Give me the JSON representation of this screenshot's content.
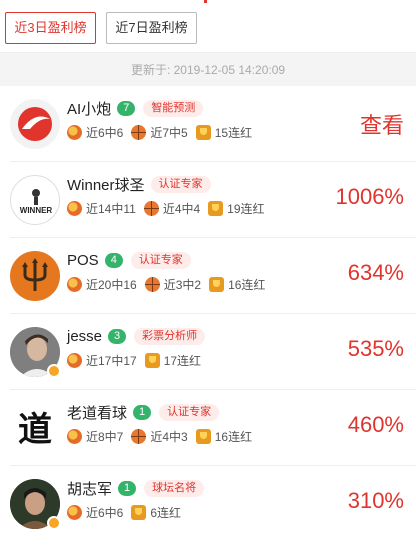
{
  "tabs": [
    {
      "label": "近3日盈利榜",
      "active": true
    },
    {
      "label": "近7日盈利榜",
      "active": false
    }
  ],
  "updated": {
    "label": "更新于:",
    "time": "2019-12-05 14:20:09"
  },
  "rows": [
    {
      "name": "AI小炮",
      "level": "7",
      "tag": "智能预测",
      "stats": [
        {
          "icon": "football-icon",
          "text": "近6中6"
        },
        {
          "icon": "basketball-icon",
          "text": "近7中5"
        },
        {
          "icon": "trophy-icon",
          "text": "15连红"
        }
      ],
      "value": "查看"
    },
    {
      "name": "Winner球圣",
      "level": "",
      "tag": "认证专家",
      "stats": [
        {
          "icon": "football-icon",
          "text": "近14中11"
        },
        {
          "icon": "basketball-icon",
          "text": "近4中4"
        },
        {
          "icon": "trophy-icon",
          "text": "19连红"
        }
      ],
      "value": "1006%"
    },
    {
      "name": "POS",
      "level": "4",
      "tag": "认证专家",
      "stats": [
        {
          "icon": "football-icon",
          "text": "近20中16"
        },
        {
          "icon": "basketball-icon",
          "text": "近3中2"
        },
        {
          "icon": "trophy-icon",
          "text": "16连红"
        }
      ],
      "value": "634%"
    },
    {
      "name": "jesse",
      "level": "3",
      "tag": "彩票分析师",
      "stats": [
        {
          "icon": "football-icon",
          "text": "近17中17"
        },
        {
          "icon": "trophy-icon",
          "text": "17连红"
        }
      ],
      "value": "535%"
    },
    {
      "name": "老道看球",
      "level": "1",
      "tag": "认证专家",
      "stats": [
        {
          "icon": "football-icon",
          "text": "近8中7"
        },
        {
          "icon": "basketball-icon",
          "text": "近4中3"
        },
        {
          "icon": "trophy-icon",
          "text": "16连红"
        }
      ],
      "value": "460%"
    },
    {
      "name": "胡志军",
      "level": "1",
      "tag": "球坛名将",
      "stats": [
        {
          "icon": "football-icon",
          "text": "近6中6"
        },
        {
          "icon": "trophy-icon",
          "text": "6连红"
        }
      ],
      "value": "310%"
    }
  ],
  "avatar_texts": {
    "winner": "WINNER",
    "dao": "道"
  },
  "colors": {
    "accent": "#e0342d",
    "level": "#34b46b",
    "tag_bg": "#fdecea"
  }
}
